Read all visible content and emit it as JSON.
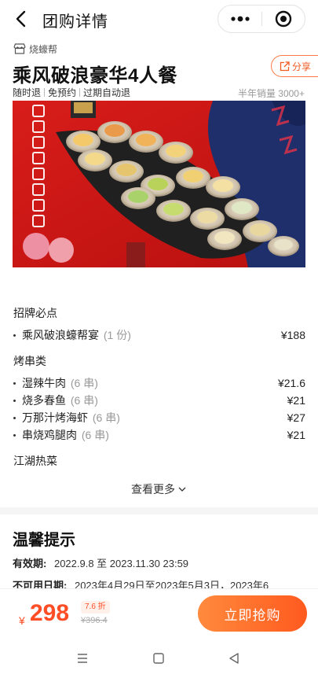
{
  "header": {
    "title": "团购详情",
    "back_icon": "back-arrow-icon",
    "more_icon": "more-dots-icon",
    "close_icon": "target-circle-icon"
  },
  "shop": {
    "name": "烧蠔帮",
    "icon": "store-icon"
  },
  "deal": {
    "title": "乘风破浪豪华4人餐",
    "share_label": "分享",
    "tags": [
      "随时退",
      "免预约",
      "过期自动退"
    ],
    "sales": "半年销量 3000+"
  },
  "banner": {
    "vertical_text": "风破浪豪华四人餐",
    "alt": "oyster platter banner"
  },
  "menu": {
    "sections": [
      {
        "name": "招牌必点",
        "items": [
          {
            "name": "乘风破浪蠔帮宴",
            "qty": "(1 份)",
            "price": "¥188"
          }
        ]
      },
      {
        "name": "烤串类",
        "items": [
          {
            "name": "湿辣牛肉",
            "qty": "(6 串)",
            "price": "¥21.6"
          },
          {
            "name": "烧多春鱼",
            "qty": "(6 串)",
            "price": "¥21"
          },
          {
            "name": "万那汁烤海虾",
            "qty": "(6 串)",
            "price": "¥27"
          },
          {
            "name": "串烧鸡腿肉",
            "qty": "(6 串)",
            "price": "¥21"
          }
        ]
      },
      {
        "name": "江湖热菜",
        "items": []
      }
    ],
    "see_more": "查看更多"
  },
  "tips": {
    "title": "温馨提示",
    "validity_label": "有效期:",
    "validity_value": "2022.9.8 至 2023.11.30 23:59",
    "unavailable_label": "不可用日期:",
    "unavailable_value": "2023年4月29日至2023年5月3日，2023年6"
  },
  "buy": {
    "currency": "¥",
    "price": "298",
    "discount": "7.6 折",
    "original": "¥396.4",
    "button_label": "立即抢购"
  },
  "colors": {
    "accent": "#ff5a1f",
    "price": "#ff4d26"
  }
}
